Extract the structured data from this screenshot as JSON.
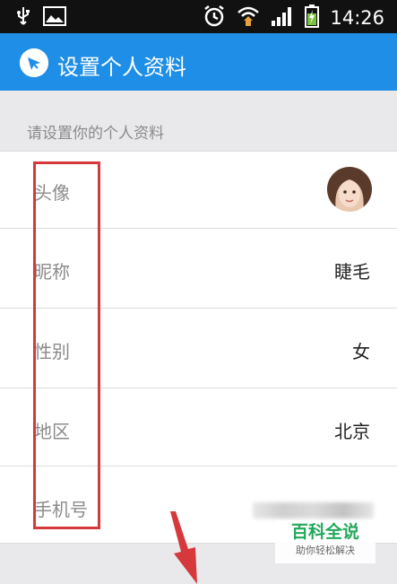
{
  "status_bar": {
    "time": "14:26",
    "icons": [
      "usb-icon",
      "image-icon",
      "alarm-icon",
      "wifi-icon",
      "signal-icon",
      "battery-icon"
    ]
  },
  "app_bar": {
    "title": "设置个人资料",
    "background": "#1f8ee6"
  },
  "section": {
    "label": "请设置你的个人资料"
  },
  "rows": [
    {
      "label": "头像",
      "value": ""
    },
    {
      "label": "昵称",
      "value": "睫毛"
    },
    {
      "label": "性别",
      "value": "女"
    },
    {
      "label": "地区",
      "value": "北京"
    },
    {
      "label": "手机号",
      "value": ""
    }
  ],
  "watermark": {
    "title": "百科全说",
    "subtitle": "助你轻松解决"
  },
  "colors": {
    "highlight": "#d6393c",
    "appbar": "#1f8ee6",
    "watermark": "#22a85a"
  }
}
